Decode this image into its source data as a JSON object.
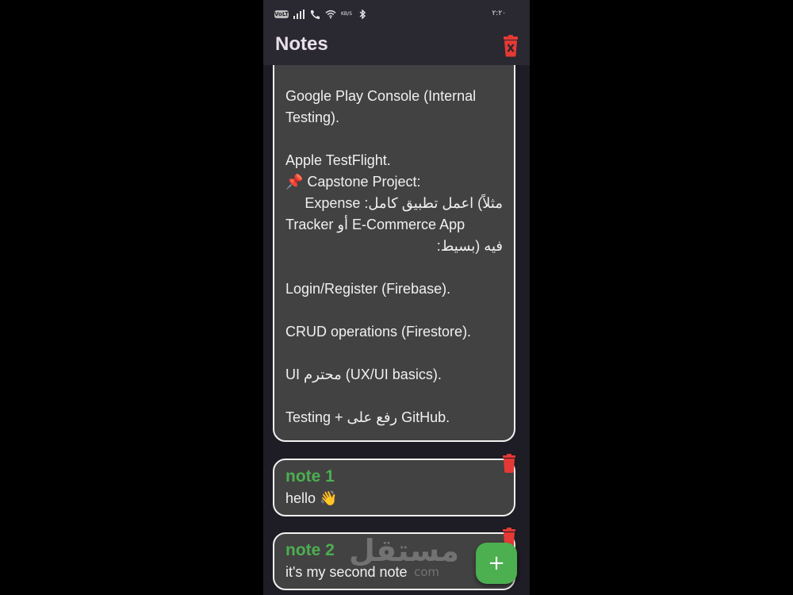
{
  "status_bar": {
    "badge": "VoLTE",
    "speed_unit": "KB/S",
    "time": "٢:٢٠",
    "icons": [
      "signal-icon",
      "phone-icon",
      "wifi-icon",
      "bluetooth-icon"
    ]
  },
  "app_bar": {
    "title": "Notes",
    "delete_all_icon": "trash-icon",
    "accent_delete": "#e53935"
  },
  "notes": [
    {
      "title": "",
      "body": "Google Play Console (Internal\nTesting).\n\nApple TestFlight.\n📌 Capstone Project:\nمثلاً) اعمل تطبيق كامل: Expense\nTracker أو E-Commerce App\nفيه (بسيط:\n\nLogin/Register (Firebase).\n\nCRUD operations (Firestore).\n\nUI محترم (UX/UI basics).\n\nTesting + رفع على GitHub."
    },
    {
      "title": "note 1",
      "body": "hello 👋"
    },
    {
      "title": "note 2",
      "body": "it's my second note"
    }
  ],
  "fab": {
    "label": "+"
  },
  "watermark": {
    "arabic": "مستقل",
    "latin": "com"
  },
  "colors": {
    "background": "#1e1c24",
    "card": "#424242",
    "card_border": "#f2f2f2",
    "title_green": "#4caf50",
    "fab_green": "#4caf50"
  }
}
